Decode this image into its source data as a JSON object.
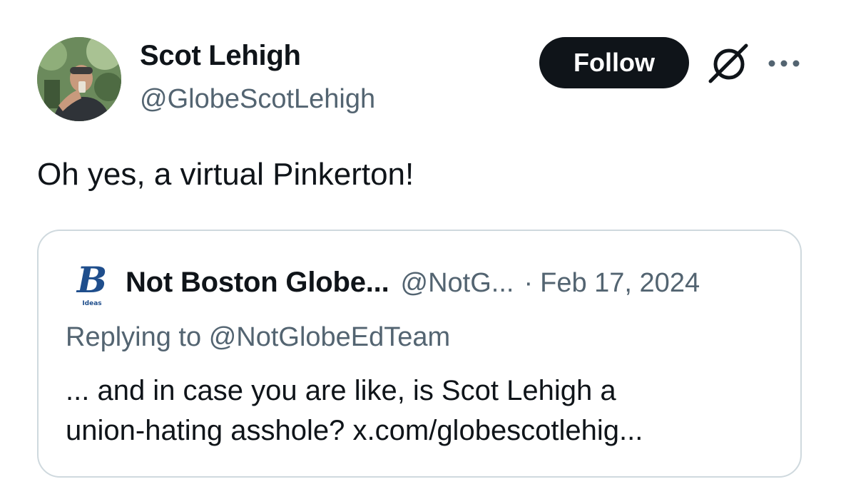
{
  "author": {
    "display_name": "Scot Lehigh",
    "handle": "@GlobeScotLehigh",
    "avatar_icon": "person-drinking-photo"
  },
  "actions": {
    "follow_label": "Follow",
    "grok_icon": "grok-slash-circle-icon",
    "more_icon": "ellipsis-icon"
  },
  "tweet": {
    "text": "Oh yes, a virtual Pinkerton!"
  },
  "quote": {
    "logo_icon": "boston-globe-ideas-logo",
    "logo_letter": "B",
    "logo_caption": "Ideas",
    "display_name": "Not Boston Globe...",
    "handle": "@NotG...",
    "separator": "·",
    "date": "Feb 17, 2024",
    "replying_prefix": "Replying to",
    "replying_handle": "@NotGlobeEdTeam",
    "body_line1": "... and in case you are like, is Scot Lehigh a",
    "body_line2": "union-hating asshole? x.com/globescotlehig..."
  },
  "colors": {
    "primary_text": "#0f1419",
    "secondary_text": "#536471",
    "button_bg": "#0f1419",
    "border": "#cfd9de",
    "logo_blue": "#1f4e8c"
  }
}
